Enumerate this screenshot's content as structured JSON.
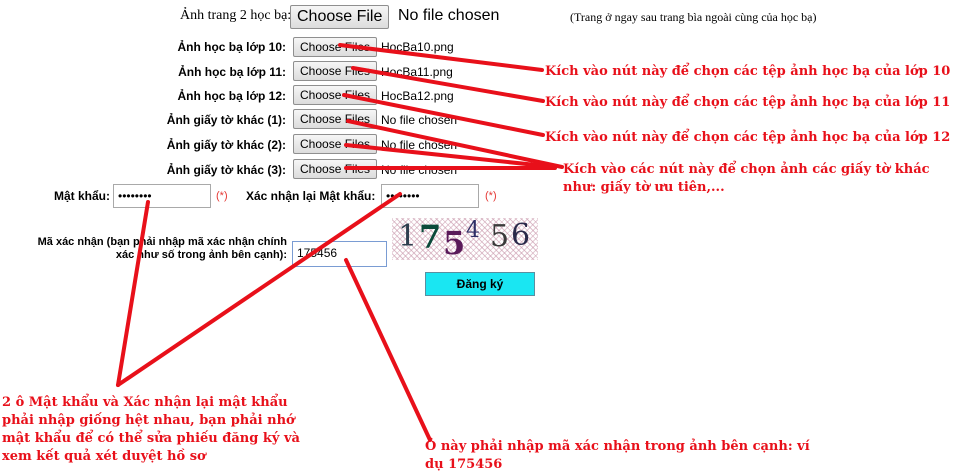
{
  "form": {
    "page2_label": "Ảnh trang 2 học bạ:",
    "page2_button": "Choose File",
    "page2_file": "No file chosen",
    "page2_note": "(Trang ở ngay sau trang bìa ngoài cùng của học bạ)",
    "rows": [
      {
        "label": "Ảnh học bạ lớp 10:",
        "button": "Choose Files",
        "file": "HocBa10.png"
      },
      {
        "label": "Ảnh học bạ lớp 11:",
        "button": "Choose Files",
        "file": "HocBa11.png"
      },
      {
        "label": "Ảnh học bạ lớp 12:",
        "button": "Choose Files",
        "file": "HocBa12.png"
      },
      {
        "label": "Ảnh giấy tờ khác (1):",
        "button": "Choose Files",
        "file": "No file chosen"
      },
      {
        "label": "Ảnh giấy tờ khác (2):",
        "button": "Choose Files",
        "file": "No file chosen"
      },
      {
        "label": "Ảnh giấy tờ khác (3):",
        "button": "Choose Files",
        "file": "No file chosen"
      }
    ],
    "password_label": "Mật khẩu:",
    "password_value": "••••••••",
    "confirm_label": "Xác nhận lại Mật khẩu:",
    "confirm_value": "••••••••",
    "required_mark": "(*)",
    "captcha_label_1": "Mã xác nhận (bạn phải nhập mã xác nhận chính",
    "captcha_label_2": "xác như số trong ảnh bên cạnh):",
    "captcha_input": "175456",
    "captcha_digits": [
      "1",
      "7",
      "5",
      "4",
      "5",
      "6"
    ],
    "submit": "Đăng ký"
  },
  "annotations": {
    "a10": "Kích vào nút này để chọn các tệp ảnh học bạ của lớp 10",
    "a11": "Kích vào nút này để chọn các tệp ảnh học bạ của lớp 11",
    "a12": "Kích vào nút này để chọn các tệp ảnh học bạ của lớp 12",
    "other_1": "Kích vào các nút này để chọn ảnh các giấy tờ khác",
    "other_2": "như: giấy tờ ưu tiên,...",
    "pw_1": "2 ô Mật khẩu và Xác nhận lại mật khẩu",
    "pw_2": "phải nhập giống hệt nhau, bạn phải nhớ",
    "pw_3": "mật khẩu để có thể sửa phiếu đăng ký và",
    "pw_4": "xem kết quả xét duyệt hồ sơ",
    "cap_1": "Ô này phải nhập mã xác nhận trong ảnh bên cạnh: ví",
    "cap_2": "dụ 175456"
  },
  "colors": {
    "annotation": "#e8101a",
    "submit_bg": "#1ae6f2",
    "required": "#e53935"
  }
}
